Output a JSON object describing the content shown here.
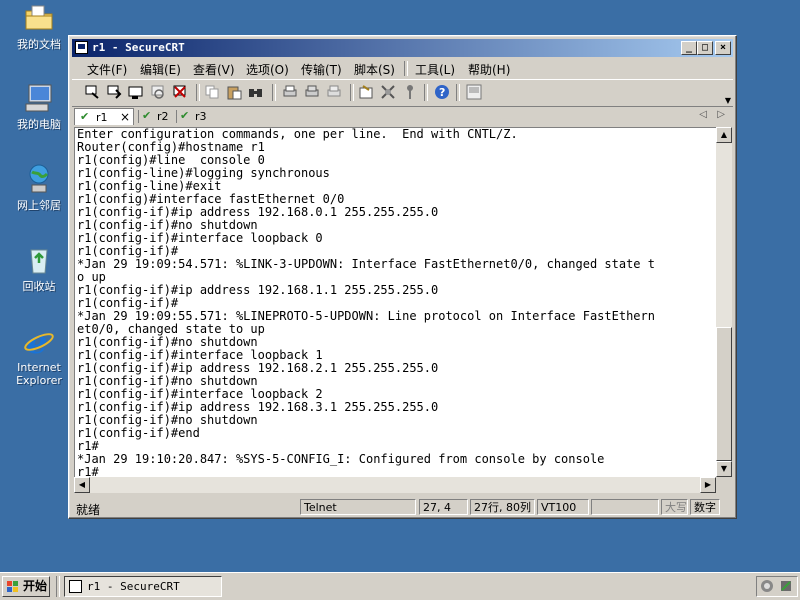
{
  "desktop": {
    "icons": [
      {
        "label": "我的文档",
        "icon": "folder-icon"
      },
      {
        "label": "我的电脑",
        "icon": "computer-icon"
      },
      {
        "label": "网上邻居",
        "icon": "network-icon"
      },
      {
        "label": "回收站",
        "icon": "recycle-bin-icon"
      },
      {
        "label": "Internet Explorer",
        "icon": "ie-icon"
      }
    ]
  },
  "window": {
    "title": "r1 - SecureCRT",
    "controls": {
      "minimize": "_",
      "maximize": "□",
      "close": "×"
    }
  },
  "menu": [
    "文件(F)",
    "编辑(E)",
    "查看(V)",
    "选项(O)",
    "传输(T)",
    "脚本(S)",
    "工具(L)",
    "帮助(H)"
  ],
  "tabs": [
    {
      "label": "r1",
      "active": true,
      "close": "×"
    },
    {
      "label": "r2",
      "active": false
    },
    {
      "label": "r3",
      "active": false
    }
  ],
  "terminal": {
    "lines": [
      "Enter configuration commands, one per line.  End with CNTL/Z.",
      "Router(config)#hostname r1",
      "r1(config)#line  console 0",
      "r1(config-line)#logging synchronous",
      "r1(config-line)#exit",
      "r1(config)#interface fastEthernet 0/0",
      "r1(config-if)#ip address 192.168.0.1 255.255.255.0",
      "r1(config-if)#no shutdown",
      "r1(config-if)#interface loopback 0",
      "r1(config-if)#",
      "*Jan 29 19:09:54.571: %LINK-3-UPDOWN: Interface FastEthernet0/0, changed state t",
      "o up",
      "r1(config-if)#ip address 192.168.1.1 255.255.255.0",
      "r1(config-if)#",
      "*Jan 29 19:09:55.571: %LINEPROTO-5-UPDOWN: Line protocol on Interface FastEthern",
      "et0/0, changed state to up",
      "r1(config-if)#no shutdown",
      "r1(config-if)#interface loopback 1",
      "r1(config-if)#ip address 192.168.2.1 255.255.255.0",
      "r1(config-if)#no shutdown",
      "r1(config-if)#interface loopback 2",
      "r1(config-if)#ip address 192.168.3.1 255.255.255.0",
      "r1(config-if)#no shutdown",
      "r1(config-if)#end",
      "r1#",
      "*Jan 29 19:10:20.847: %SYS-5-CONFIG_I: Configured from console by console",
      "r1#"
    ]
  },
  "status": {
    "ready": "就绪",
    "protocol": "Telnet",
    "cursor": "27,  4",
    "rows_cols": "27行, 80列",
    "emulation": "VT100",
    "caps": "大写",
    "num": "数字"
  },
  "taskbar": {
    "start": "开始",
    "task": "r1 - SecureCRT"
  },
  "colors": {
    "desktop": "#3a6ea5",
    "title_start": "#0a246a",
    "title_end": "#a6caf0",
    "chrome": "#d4d0c8"
  }
}
